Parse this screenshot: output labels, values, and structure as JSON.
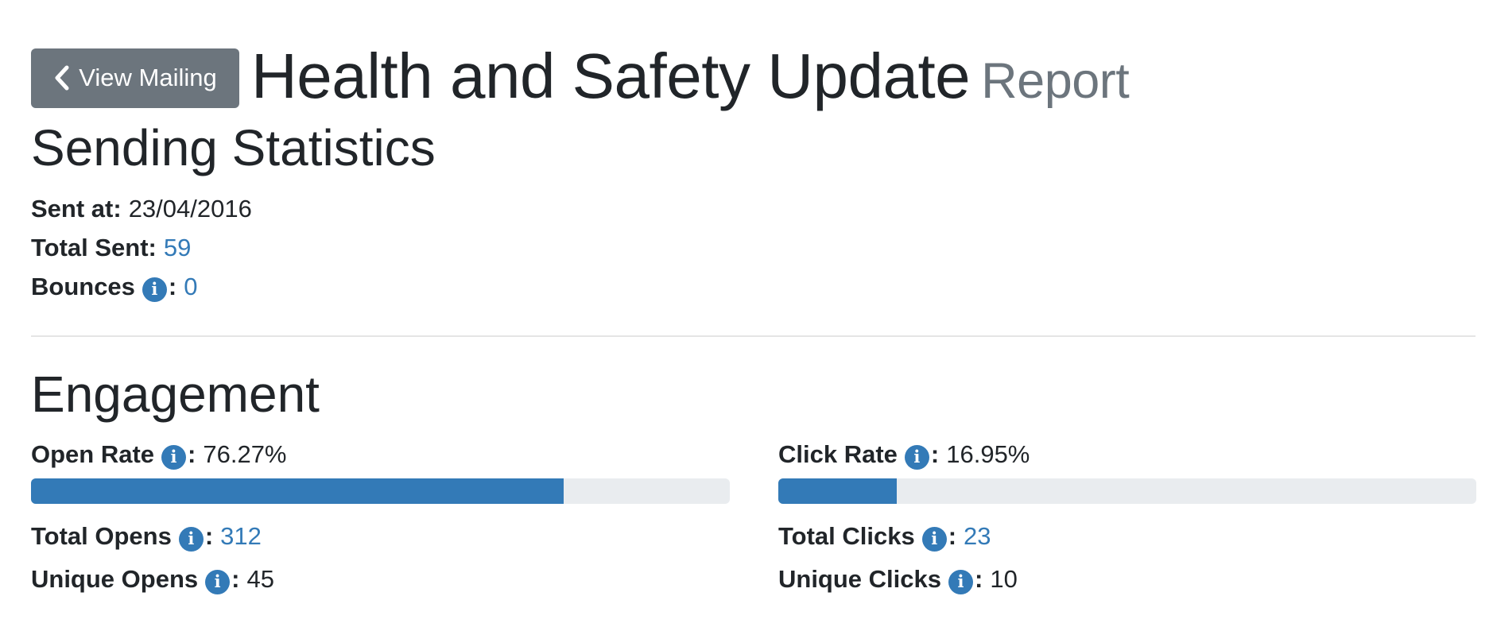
{
  "header": {
    "back_button_label": "View Mailing",
    "title": "Health and Safety Update",
    "subtitle": "Report"
  },
  "sending_statistics": {
    "heading": "Sending Statistics",
    "sent_at_label": "Sent at:",
    "sent_at_value": "23/04/2016",
    "total_sent_label": "Total Sent:",
    "total_sent_value": "59",
    "bounces_label": "Bounces",
    "bounces_value": "0"
  },
  "engagement": {
    "heading": "Engagement",
    "open_rate_label": "Open Rate",
    "open_rate_value": "76.27%",
    "open_rate_fraction": 0.7627,
    "total_opens_label": "Total Opens",
    "total_opens_value": "312",
    "unique_opens_label": "Unique Opens",
    "unique_opens_value": "45",
    "click_rate_label": "Click Rate",
    "click_rate_value": "16.95%",
    "click_rate_fraction": 0.1695,
    "total_clicks_label": "Total Clicks",
    "total_clicks_value": "23",
    "unique_clicks_label": "Unique Clicks",
    "unique_clicks_value": "10"
  },
  "icons": {
    "info": "i",
    "back": "chevron-left-icon"
  },
  "colors": {
    "accent": "#337ab7",
    "button_bg": "#6c757d",
    "muted_text": "#6c757d",
    "progress_track": "#e9ecef",
    "divider": "#e5e5e5"
  }
}
